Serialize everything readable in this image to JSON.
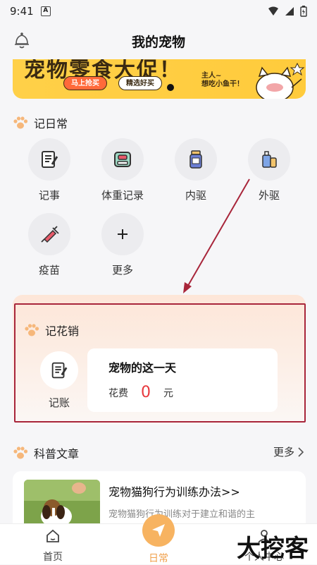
{
  "status": {
    "time": "9:41",
    "a": "A"
  },
  "header": {
    "title": "我的宠物"
  },
  "banner": {
    "headline": "宠物零食大促！",
    "btn_buy": "马上抢买",
    "btn_fine": "精选好买",
    "speech": "主人~\n想吃小鱼干！"
  },
  "daily": {
    "title": "记日常",
    "items": [
      {
        "label": "记事"
      },
      {
        "label": "体重记录"
      },
      {
        "label": "内驱"
      },
      {
        "label": "外驱"
      },
      {
        "label": "疫苗"
      },
      {
        "label": "更多"
      }
    ]
  },
  "expense": {
    "title": "记花销",
    "account_label": "记账",
    "day_title": "宠物的这一天",
    "spend_label": "花费",
    "spend_value": "0",
    "unit": "元"
  },
  "articles": {
    "title": "科普文章",
    "more": "更多",
    "items": [
      {
        "title": "宠物猫狗行为训练办法>>",
        "desc": "宠物猫狗行为训练对于建立和谐的主"
      }
    ]
  },
  "tabbar": {
    "home": "首页",
    "daily": "日常",
    "me": "个人中心"
  },
  "watermark": "大挖客",
  "colors": {
    "accent": "#f7b361",
    "frame": "#a8253a",
    "amount": "#e8383d"
  }
}
